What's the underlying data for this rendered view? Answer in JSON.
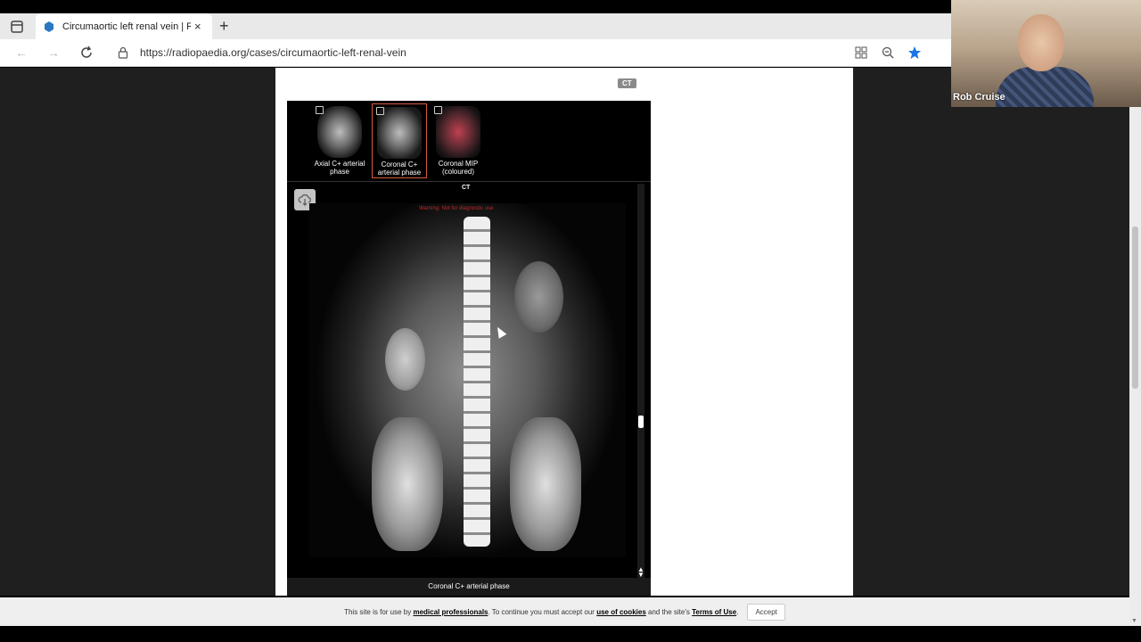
{
  "browser": {
    "tab_title": "Circumaortic left renal vein | Rad",
    "url": "https://radiopaedia.org/cases/circumaortic-left-renal-vein",
    "new_tab_label": "+",
    "tab_close": "×"
  },
  "case": {
    "modality_badge": "CT",
    "series": [
      {
        "label": "Axial C+ arterial phase",
        "selected": false
      },
      {
        "label": "Coronal C+ arterial phase",
        "selected": true
      },
      {
        "label": "Coronal MIP (coloured)",
        "selected": false
      }
    ],
    "viewer_modality": "CT",
    "watermark": "Warning: Not for diagnostic use",
    "caption": "Coronal C+ arterial phase"
  },
  "cookie_bar": {
    "text_1": "This site is for use by ",
    "link_professionals": "medical professionals",
    "text_2": ". To continue you must accept our ",
    "link_cookies": "use of cookies",
    "text_3": " and the site's ",
    "link_terms": "Terms of Use",
    "text_4": ".",
    "accept_label": "Accept"
  },
  "webcam": {
    "participant_name": "Rob Cruise"
  },
  "colors": {
    "selected_border": "#d75b3e",
    "star": "#1a73e8",
    "watermark": "#b82b2b"
  }
}
